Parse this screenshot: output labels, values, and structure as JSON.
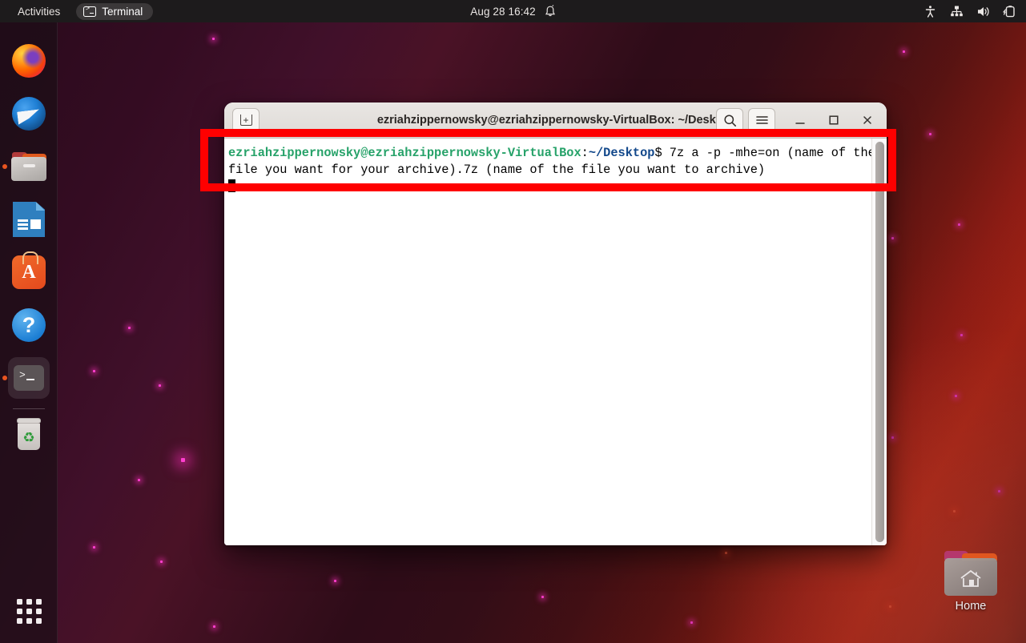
{
  "topbar": {
    "activities": "Activities",
    "app_name": "Terminal",
    "app_icon": "terminal-icon",
    "clock": "Aug 28  16:42",
    "notification_icon": "bell-icon",
    "tray": [
      {
        "name": "accessibility-icon",
        "label": "Accessibility"
      },
      {
        "name": "network-icon",
        "label": "Network"
      },
      {
        "name": "volume-icon",
        "label": "Volume"
      },
      {
        "name": "battery-icon",
        "label": "Battery"
      }
    ]
  },
  "dock": {
    "items": [
      {
        "name": "dock-item-firefox",
        "label": "Firefox",
        "icon": "firefox-icon",
        "running": false,
        "active": false
      },
      {
        "name": "dock-item-thunderbird",
        "label": "Thunderbird Mail",
        "icon": "thunderbird-icon",
        "running": false,
        "active": false
      },
      {
        "name": "dock-item-files",
        "label": "Files",
        "icon": "files-folder-icon",
        "running": true,
        "active": false
      },
      {
        "name": "dock-item-libreoffice",
        "label": "LibreOffice Writer",
        "icon": "libreoffice-icon",
        "running": false,
        "active": false
      },
      {
        "name": "dock-item-software",
        "label": "Ubuntu Software",
        "icon": "software-store-icon",
        "running": false,
        "active": false
      },
      {
        "name": "dock-item-help",
        "label": "Help",
        "icon": "help-question-icon",
        "running": false,
        "active": false
      },
      {
        "name": "dock-item-terminal",
        "label": "Terminal",
        "icon": "terminal-icon",
        "running": true,
        "active": true
      },
      {
        "name": "dock-item-trash",
        "label": "Trash",
        "icon": "trash-icon",
        "running": false,
        "active": false
      }
    ],
    "show_apps_label": "Show Applications"
  },
  "desktop": {
    "home_icon": {
      "label": "Home",
      "icon": "home-folder-icon"
    }
  },
  "window": {
    "title": "ezriahzippernowsky@ezriahzippernowsky-VirtualBox: ~/Desktop",
    "new_tab_label": "+",
    "buttons": {
      "search": "search-icon",
      "menu": "hamburger-menu-icon",
      "minimize": "minimize-icon",
      "maximize": "maximize-icon",
      "close": "close-icon"
    }
  },
  "terminal": {
    "prompt_user": "ezriahzippernowsky@ezriahzippernowsky-VirtualBox",
    "prompt_sep": ":",
    "prompt_path": "~/Desktop",
    "prompt_symbol": "$ ",
    "command": "7z a -p -mhe=on (name of the file you want for your archive).7z (name of the file you want to archive)",
    "cursor": "block-cursor"
  },
  "annotation": {
    "name": "red-highlight-box",
    "color": "#fe0000",
    "targets": "terminal command line"
  },
  "colors": {
    "prompt_user": "#26a269",
    "prompt_path": "#12488b",
    "terminal_bg": "#ffffff",
    "terminal_fg": "#000000",
    "annotation": "#fe0000",
    "accent": "#e95420"
  }
}
